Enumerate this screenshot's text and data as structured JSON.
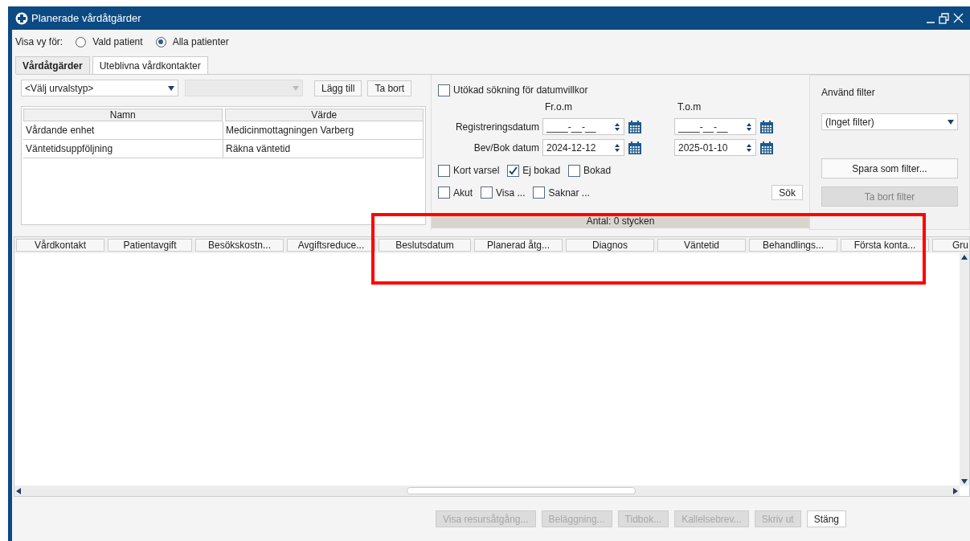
{
  "window": {
    "title": "Planerade vårdåtgärder"
  },
  "view_for": {
    "label": "Visa vy för:",
    "options": [
      {
        "label": "Vald patient",
        "selected": false
      },
      {
        "label": "Alla patienter",
        "selected": true
      }
    ]
  },
  "tabs": [
    {
      "label": "Vårdåtgärder",
      "selected": true
    },
    {
      "label": "Uteblivna vårdkontakter",
      "selected": false
    }
  ],
  "selection": {
    "type_dropdown": "<Välj urvalstyp>",
    "buttons": [
      "Lägg till",
      "Ta bort"
    ],
    "columns": [
      "Namn",
      "Värde"
    ],
    "rows": [
      [
        "Vårdande enhet",
        "Medicinmottagningen Varberg"
      ],
      [
        "Väntetidsuppföljning",
        "Räkna väntetid"
      ]
    ]
  },
  "date_search": {
    "extended": {
      "label": "Utökad sökning för datumvillkor",
      "checked": false
    },
    "from_label": "Fr.o.m",
    "to_label": "T.o.m",
    "rows": [
      {
        "label": "Registreringsdatum",
        "from": "____-__-__",
        "to": "____-__-__"
      },
      {
        "label": "Bev/Bok datum",
        "from": "2024-12-12",
        "to": "2025-01-10"
      }
    ],
    "checkboxes": [
      [
        {
          "label": "Kort varsel",
          "checked": false
        },
        {
          "label": "Ej bokad",
          "checked": true
        },
        {
          "label": "Bokad",
          "checked": false
        }
      ],
      [
        {
          "label": "Akut",
          "checked": false
        },
        {
          "label": "Visa ...",
          "checked": false
        },
        {
          "label": "Saknar ...",
          "checked": false
        }
      ]
    ],
    "search_button": "Sök",
    "count": "Antal: 0 stycken"
  },
  "filter": {
    "label": "Använd filter",
    "value": "(Inget filter)",
    "buttons": [
      {
        "label": "Spara som filter...",
        "disabled": false
      },
      {
        "label": "Ta bort filter",
        "disabled": true
      }
    ]
  },
  "table": {
    "columns": [
      "Vårdkontakt",
      "Patientavgift",
      "Besökskostn...",
      "Avgiftsreduce...",
      "Beslutsdatum",
      "Planerad åtg...",
      "Diagnos",
      "Väntetid",
      "Behandlings...",
      "Första konta...",
      "Gru"
    ]
  },
  "buttons": [
    {
      "label": "Visa resursåtgång...",
      "disabled": true
    },
    {
      "label": "Beläggning...",
      "disabled": true
    },
    {
      "label": "Tidbok...",
      "disabled": true
    },
    {
      "label": "Kallelsebrev...",
      "disabled": true
    },
    {
      "label": "Skriv ut",
      "disabled": true
    },
    {
      "label": "Stäng",
      "disabled": false
    }
  ]
}
